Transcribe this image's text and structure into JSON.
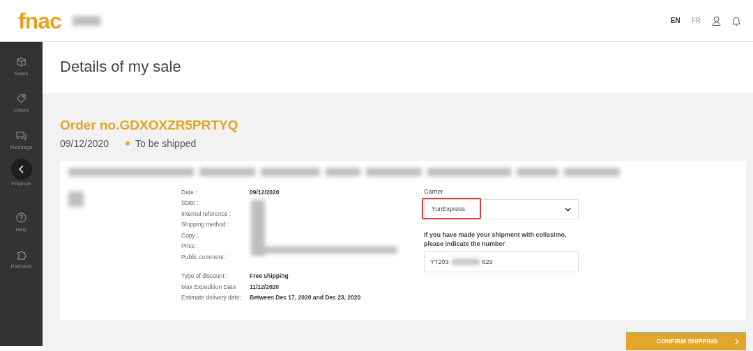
{
  "header": {
    "logo": "fnac",
    "languages": [
      {
        "label": "EN",
        "selected": true
      },
      {
        "label": "FR",
        "selected": false
      }
    ]
  },
  "sidebar": {
    "items": [
      {
        "label": "Sales"
      },
      {
        "label": "Offers"
      },
      {
        "label": "Message"
      },
      {
        "label": "Finance"
      },
      {
        "label": "Help"
      },
      {
        "label": "Partners"
      }
    ]
  },
  "page_title": "Details of my sale",
  "order": {
    "title": "Order no.GDXOXZR5PRTYQ",
    "date": "09/12/2020",
    "status": "To be shipped"
  },
  "details": [
    [
      {
        "label": "Date :",
        "value": "09/12/2020"
      },
      {
        "label": "State :"
      },
      {
        "label": "Internal reference :"
      },
      {
        "label": "Shipping method :"
      },
      {
        "label": "Copy :"
      },
      {
        "label": "Price :"
      },
      {
        "label": "Public comment :"
      }
    ],
    [
      {
        "label": "Type of discount :",
        "value": "Free shipping"
      },
      {
        "label": "Max Expedition Date",
        "value": "11/12/2020"
      },
      {
        "label": "Estimate delivery date:",
        "value": "Between Dec 17, 2020 and Dec 23, 2020"
      }
    ]
  ],
  "carrier": {
    "label": "Carrier",
    "value": "YunExpress"
  },
  "tracking": {
    "label": "If you have made your shipment with colissimo, please indicate the number",
    "value_start": "YT203",
    "value_end": "629"
  },
  "confirm_button": "CONFIRM SHIPPING"
}
